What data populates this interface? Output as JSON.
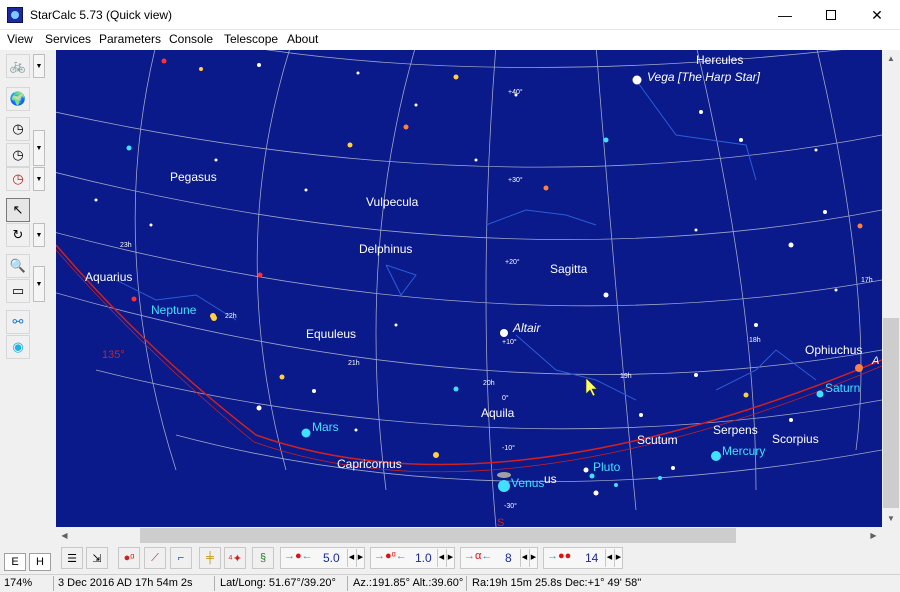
{
  "window": {
    "title": "StarCalc 5.73 (Quick view)",
    "minimize_glyph": "—",
    "close_glyph": "✕"
  },
  "menu": {
    "items": [
      "View",
      "Services",
      "Parameters",
      "Console",
      "Telescope",
      "About"
    ]
  },
  "left_toolbar": {
    "buttons": [
      {
        "name": "telescope-icon",
        "glyph": "🚲"
      },
      {
        "name": "globe-icon",
        "glyph": "🌍"
      },
      {
        "name": "clock-plus-icon",
        "glyph": "◷"
      },
      {
        "name": "clock-icon",
        "glyph": "◷"
      },
      {
        "name": "clock-now-icon",
        "glyph": "◷"
      },
      {
        "name": "pointer-icon",
        "glyph": "↖"
      },
      {
        "name": "rotate-icon",
        "glyph": "↻"
      },
      {
        "name": "zoom-icon",
        "glyph": "🔍"
      },
      {
        "name": "select-rect-icon",
        "glyph": "▭"
      },
      {
        "name": "connect-icon",
        "glyph": "⚯"
      },
      {
        "name": "center-object-icon",
        "glyph": "◉"
      }
    ]
  },
  "sky": {
    "colors": {
      "background": "#0a1a8a",
      "grid": "#9ea6c8",
      "constellation_label": "#ffffff",
      "planet_label": "#40e0ff",
      "horizon": "#d02020",
      "constellation_lines": "#2a5cd8"
    },
    "constellations": [
      "Hercules",
      "Pegasus",
      "Vulpecula",
      "Delphinus",
      "Sagitta",
      "Aquarius",
      "Equuleus",
      "Aquila",
      "Ophiuchus",
      "Scutum",
      "Serpens",
      "Scorpius",
      "Capricornus",
      "us"
    ],
    "stars_named": [
      "Vega [The Harp Star]",
      "Altair"
    ],
    "planets": [
      "Neptune",
      "Mars",
      "Venus",
      "Pluto",
      "Mercury",
      "Saturn"
    ],
    "declination_labels": [
      "+40°",
      "+30°",
      "+20°",
      "+10°",
      "0°",
      "-10°",
      "-30°"
    ],
    "ra_labels": [
      "23h",
      "22h",
      "21h",
      "20h",
      "19h",
      "18h",
      "17h"
    ],
    "azimuth_label": "135°",
    "south_label": "S",
    "edge_label": "A"
  },
  "bottom_toolbar": {
    "lang_e": "E",
    "lang_h": "H",
    "mag_controls": [
      {
        "name": "star-magnitude",
        "value": "5.0"
      },
      {
        "name": "galaxy-magnitude",
        "value": "1.0"
      },
      {
        "name": "label-magnitude",
        "value": "8"
      },
      {
        "name": "planet-size",
        "value": "14"
      }
    ]
  },
  "status": {
    "zoom": "174%",
    "datetime": "3 Dec 2016 AD 17h 54m 2s",
    "latlong": "Lat/Long: 51.67°/39.20°",
    "azalt": "Az.:191.85° Alt.:39.60°",
    "radec": "Ra:19h 15m 25.8s Dec:+1° 49' 58''"
  }
}
